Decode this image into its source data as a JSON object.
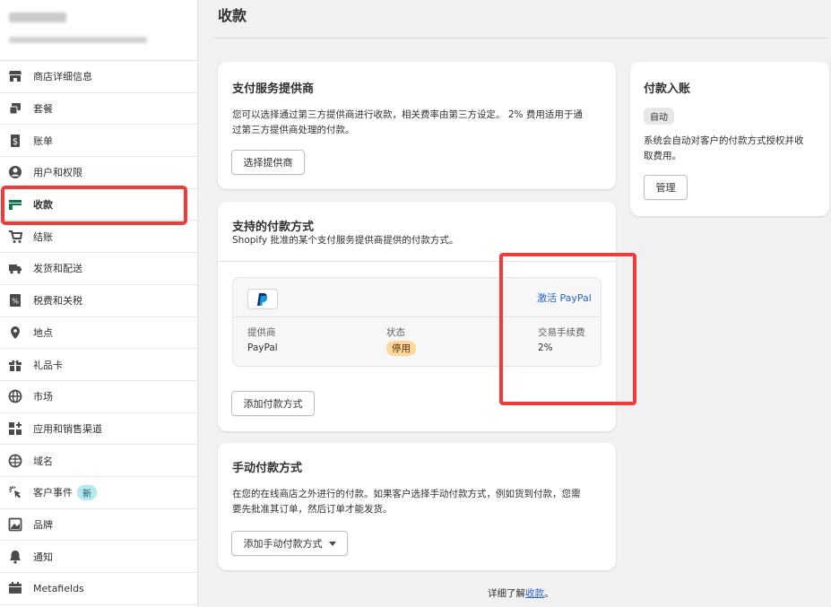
{
  "page": {
    "title": "收款"
  },
  "sidebar": {
    "items": [
      {
        "label": "商店详细信息",
        "icon": "store-icon",
        "active": false
      },
      {
        "label": "套餐",
        "icon": "plan-icon",
        "active": false
      },
      {
        "label": "账单",
        "icon": "billing-icon",
        "active": false
      },
      {
        "label": "用户和权限",
        "icon": "user-icon",
        "active": false
      },
      {
        "label": "收款",
        "icon": "payments-icon",
        "active": true
      },
      {
        "label": "结账",
        "icon": "cart-icon",
        "active": false
      },
      {
        "label": "发货和配送",
        "icon": "truck-icon",
        "active": false
      },
      {
        "label": "税费和关税",
        "icon": "tax-icon",
        "active": false
      },
      {
        "label": "地点",
        "icon": "location-icon",
        "active": false
      },
      {
        "label": "礼品卡",
        "icon": "gift-icon",
        "active": false
      },
      {
        "label": "市场",
        "icon": "globe-icon",
        "active": false
      },
      {
        "label": "应用和销售渠道",
        "icon": "apps-icon",
        "active": false
      },
      {
        "label": "域名",
        "icon": "domain-icon",
        "active": false
      },
      {
        "label": "客户事件",
        "icon": "cursor-click-icon",
        "active": false,
        "badge": "新"
      },
      {
        "label": "品牌",
        "icon": "brand-icon",
        "active": false
      },
      {
        "label": "通知",
        "icon": "bell-icon",
        "active": false
      },
      {
        "label": "Metafields",
        "icon": "metafields-icon",
        "active": false
      }
    ]
  },
  "provider_card": {
    "title": "支付服务提供商",
    "desc_line1": "您可以选择通过第三方提供商进行收款，相关费率由第三方设定。 2% 费用适用于通",
    "desc_line2": "过第三方提供商处理的付款。",
    "button": "选择提供商"
  },
  "supported_card": {
    "title": "支持的付款方式",
    "subtitle": "Shopify 批准的某个支付服务提供商提供的付款方式。",
    "activate_link": "激活 PayPal",
    "col_provider": "提供商",
    "col_status": "状态",
    "col_fee": "交易手续费",
    "provider": "PayPal",
    "status": "停用",
    "fee": "2%",
    "add_button": "添加付款方式"
  },
  "manual_card": {
    "title": "手动付款方式",
    "desc_line1": "在您的在线商店之外进行的付款。如果客户选择手动付款方式，例如货到付款，您需",
    "desc_line2": "要先批准其订单，然后订单才能发货。",
    "button": "添加手动付款方式"
  },
  "payout_card": {
    "title": "付款入账",
    "status": "自动",
    "desc_line1": "系统会自动对客户的付款方式授权并收",
    "desc_line2": "取费用。",
    "button": "管理"
  },
  "footer": {
    "prefix": "详细了解",
    "link": "收款",
    "suffix": "。"
  },
  "colors": {
    "highlight": "#f23a3a",
    "active_icon": "#0a7a4a",
    "link": "#2b63d9",
    "badge_new_bg": "#b4e9f0",
    "pill_disabled_bg": "#ffd79d"
  }
}
